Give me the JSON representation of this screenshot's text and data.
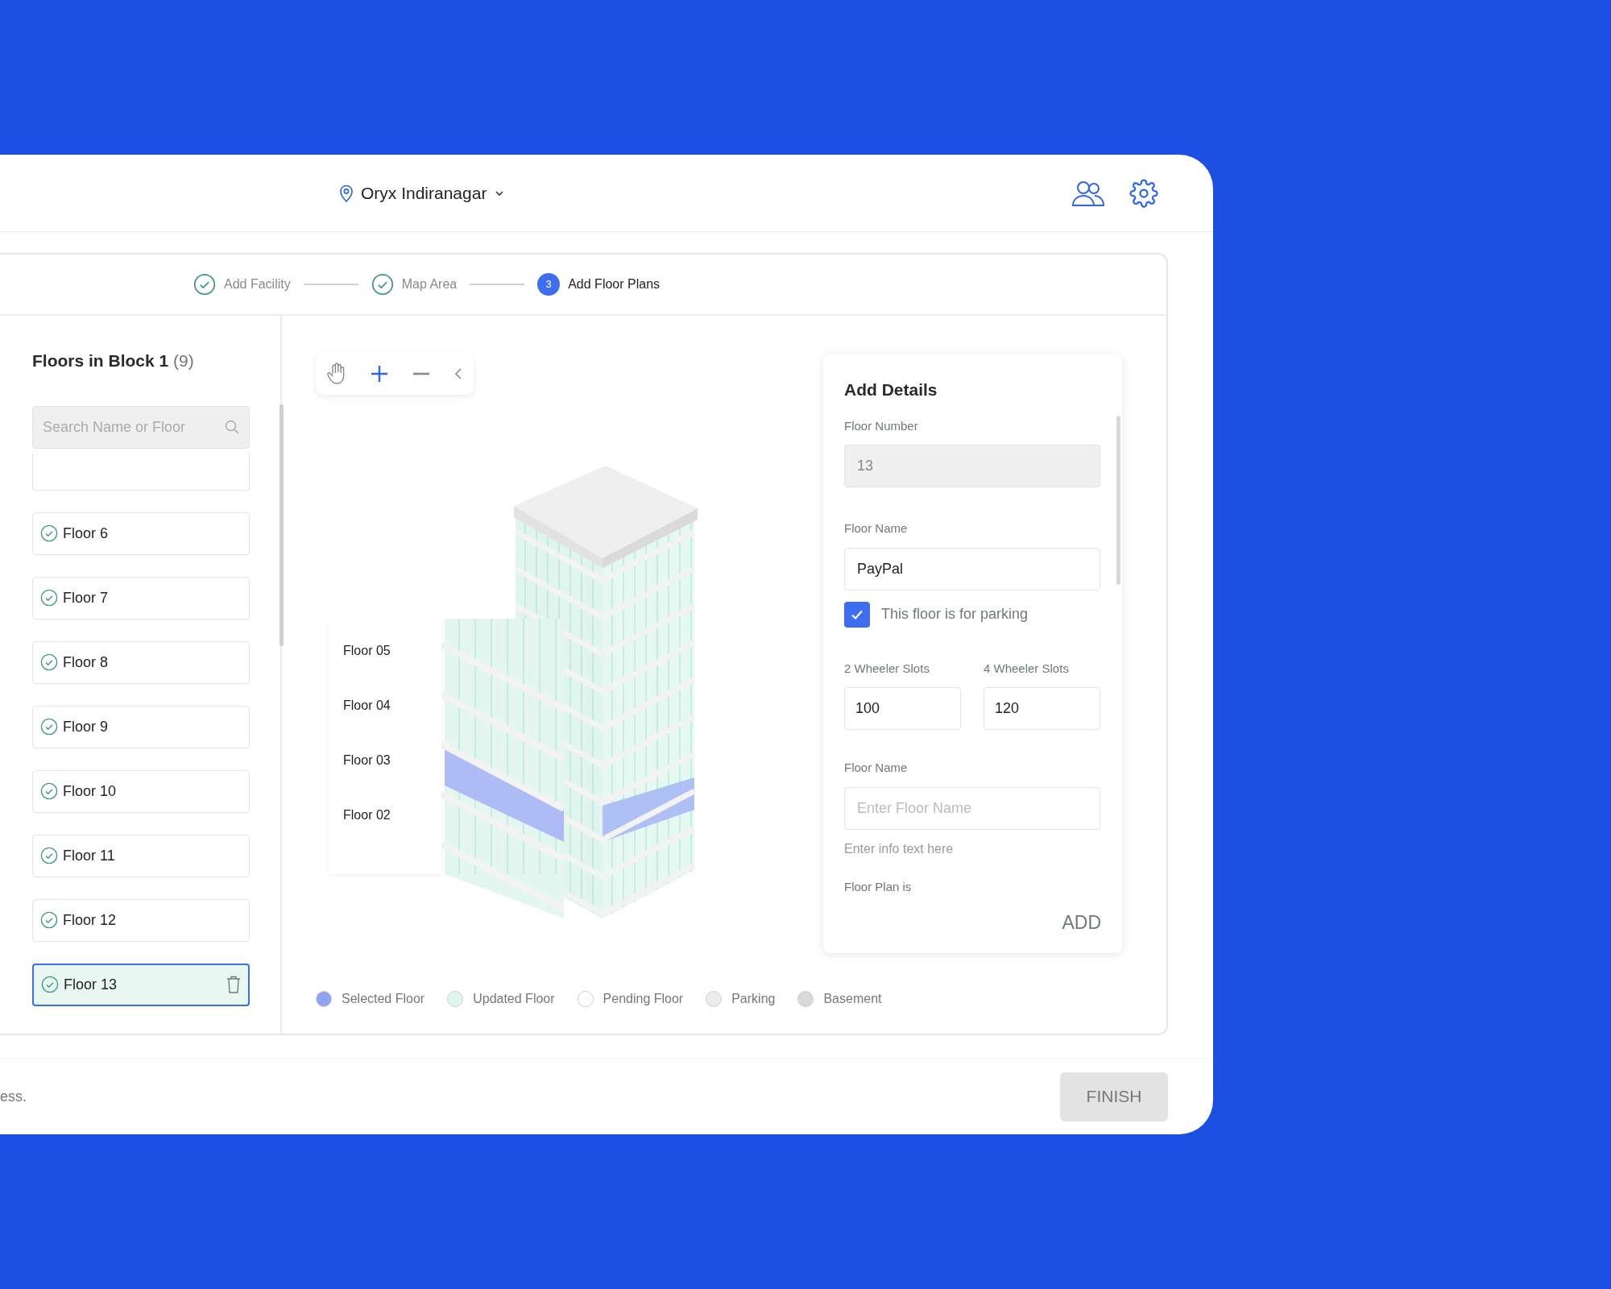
{
  "header": {
    "location": "Oryx Indiranagar"
  },
  "stepper": [
    {
      "label": "Add Facility",
      "done": true
    },
    {
      "label": "Map Area",
      "done": true
    },
    {
      "label": "Add Floor Plans",
      "done": false,
      "number": "3"
    }
  ],
  "sidebar": {
    "title": "Floors in Block 1",
    "count": "(9)",
    "search_placeholder": "Search Name or Floor",
    "floors": [
      {
        "kind": "clipped",
        "selected": false
      },
      {
        "kind": "full",
        "label": "Floor 6",
        "selected": false
      },
      {
        "kind": "full",
        "label": "Floor 7",
        "selected": false
      },
      {
        "kind": "full",
        "label": "Floor 8",
        "selected": false
      },
      {
        "kind": "full",
        "label": "Floor 9",
        "selected": false
      },
      {
        "kind": "full",
        "label": "Floor 10",
        "selected": false
      },
      {
        "kind": "full",
        "label": "Floor 11",
        "selected": false
      },
      {
        "kind": "full",
        "label": "Floor 12",
        "selected": false
      },
      {
        "kind": "full",
        "label": "Floor 13",
        "selected": true
      }
    ]
  },
  "canvas": {
    "floor_labels": [
      "Floor 05",
      "Floor 04",
      "Floor 03",
      "Floor 02"
    ],
    "legend": [
      {
        "label": "Selected Floor",
        "color": "#8ea4f0"
      },
      {
        "label": "Updated Floor",
        "color": "#dff5ef"
      },
      {
        "label": "Pending Floor",
        "color": "#ffffff"
      },
      {
        "label": "Parking",
        "color": "#ececec"
      },
      {
        "label": "Basement",
        "color": "#d9d9d9"
      }
    ]
  },
  "details": {
    "title": "Add Details",
    "floor_number": {
      "label": "Floor Number",
      "value": "13",
      "disabled": true
    },
    "floor_name": {
      "label": "Floor Name",
      "value": "PayPal"
    },
    "parking": {
      "label": "This floor is for parking",
      "checked": true
    },
    "slots": [
      {
        "label": "2 Wheeler Slots",
        "value": "100"
      },
      {
        "label": "4 Wheeler Slots",
        "value": "120"
      }
    ],
    "floor_name_2": {
      "label": "Floor Name",
      "placeholder": "Enter Floor Name",
      "hint": "Enter info text here"
    },
    "next_label": "Floor Plan is",
    "add_button": "ADD"
  },
  "footer": {
    "note": "ess.",
    "button": "FINISH"
  }
}
